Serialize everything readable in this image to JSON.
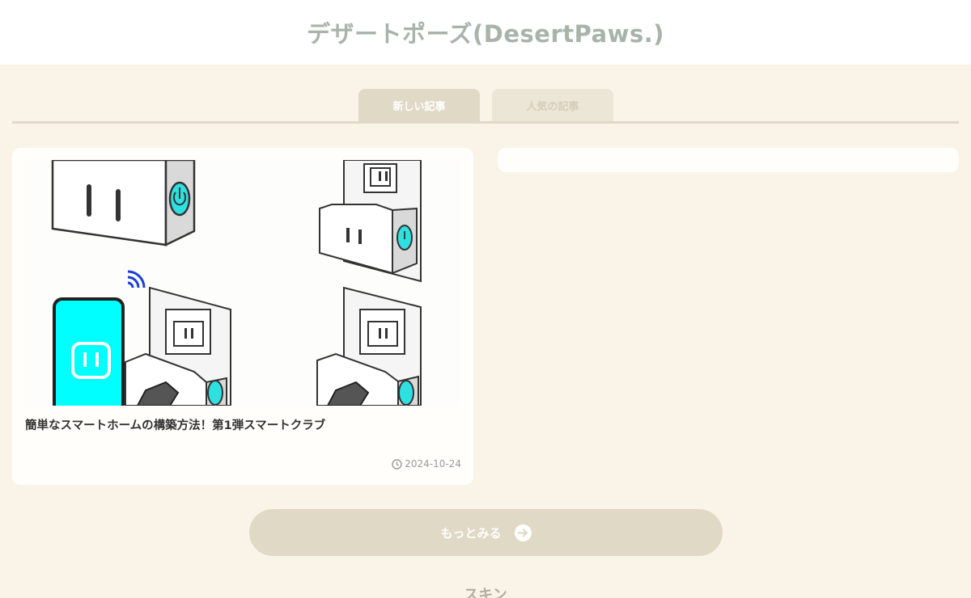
{
  "header": {
    "site_title": "デザートポーズ(DesertPaws.)"
  },
  "tabs": [
    {
      "label": "新しい記事",
      "active": true
    },
    {
      "label": "人気の記事",
      "active": false
    }
  ],
  "articles": [
    {
      "title": "簡単なスマートホームの構築方法！第1弾スマートクラブ",
      "date": "2024-10-24"
    }
  ],
  "more_button": {
    "label": "もっとみる"
  },
  "section": {
    "heading": "スキン"
  },
  "colors": {
    "background": "#faf3e8",
    "accent": "#e0d9c6",
    "title": "#a8b4ab",
    "card": "#fffefa",
    "device_screen": "#00ffff"
  }
}
